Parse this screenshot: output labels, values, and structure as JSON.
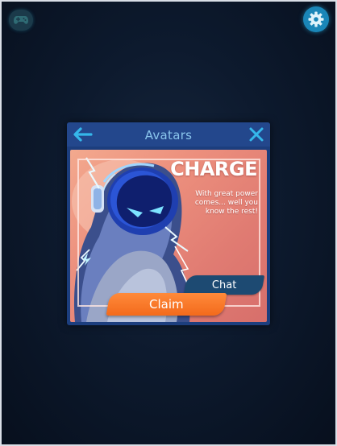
{
  "header": {
    "left_icon": "game-controller-icon",
    "right_icon": "settings-gear-icon"
  },
  "modal": {
    "title": "Avatars",
    "back_icon": "back-arrow-icon",
    "close_icon": "close-icon",
    "card": {
      "headline": "CHARGE",
      "blurb": "With great power comes... well you know the rest!",
      "chat_label": "Chat",
      "claim_label": "Claim",
      "art": "lightning-hero-avatar"
    }
  },
  "colors": {
    "background": "#0d1a2e",
    "modal": "#1c3e7e",
    "accent_blue": "#1a86b8",
    "title_text": "#8ac5ec",
    "card_bg": "#ec8f7d",
    "chat_button": "#1d4a72",
    "claim_button": "#f36a1c"
  }
}
